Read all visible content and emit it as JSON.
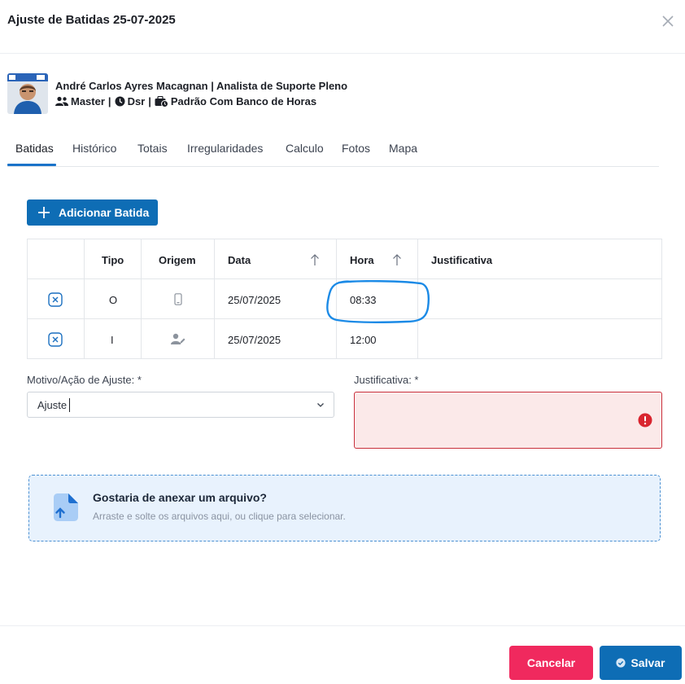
{
  "modal": {
    "title": "Ajuste de Batidas 25-07-2025"
  },
  "employee": {
    "name_role": "André Carlos Ayres Macagnan | Analista de Suporte Pleno",
    "group": "Master",
    "schedule": "Dsr",
    "policy": "Padrão Com Banco de Horas",
    "separator": "|"
  },
  "tabs": [
    {
      "label": "Batidas",
      "active": true
    },
    {
      "label": "Histórico"
    },
    {
      "label": "Totais"
    },
    {
      "label": "Irregularidades"
    },
    {
      "label": "Calculo"
    },
    {
      "label": "Fotos"
    },
    {
      "label": "Mapa"
    }
  ],
  "actions": {
    "add_label": "Adicionar Batida"
  },
  "table": {
    "columns": [
      "",
      "Tipo",
      "Origem",
      "Data",
      "Hora",
      "Justificativa"
    ],
    "rows": [
      {
        "tipo": "O",
        "origem_icon": "mobile-phone-icon",
        "data": "25/07/2025",
        "hora": "08:33",
        "justificativa": ""
      },
      {
        "tipo": "I",
        "origem_icon": "user-edit-icon",
        "data": "25/07/2025",
        "hora": "12:00",
        "justificativa": ""
      }
    ]
  },
  "form": {
    "motivo_label": "Motivo/Ação de Ajuste: *",
    "motivo_value": "Ajuste",
    "justificativa_label": "Justificativa: *",
    "justificativa_value": ""
  },
  "upload": {
    "title": "Gostaria de anexar um arquivo?",
    "subtitle": "Arraste e solte os arquivos aqui, ou clique para selecionar."
  },
  "footer": {
    "cancel_label": "Cancelar",
    "save_label": "Salvar"
  },
  "colors": {
    "primary": "#0e6db5",
    "danger": "#f0295e",
    "error_border": "#c9303c",
    "error_bg": "#fbe9e9",
    "dropzone_bg": "#e8f2fd"
  }
}
